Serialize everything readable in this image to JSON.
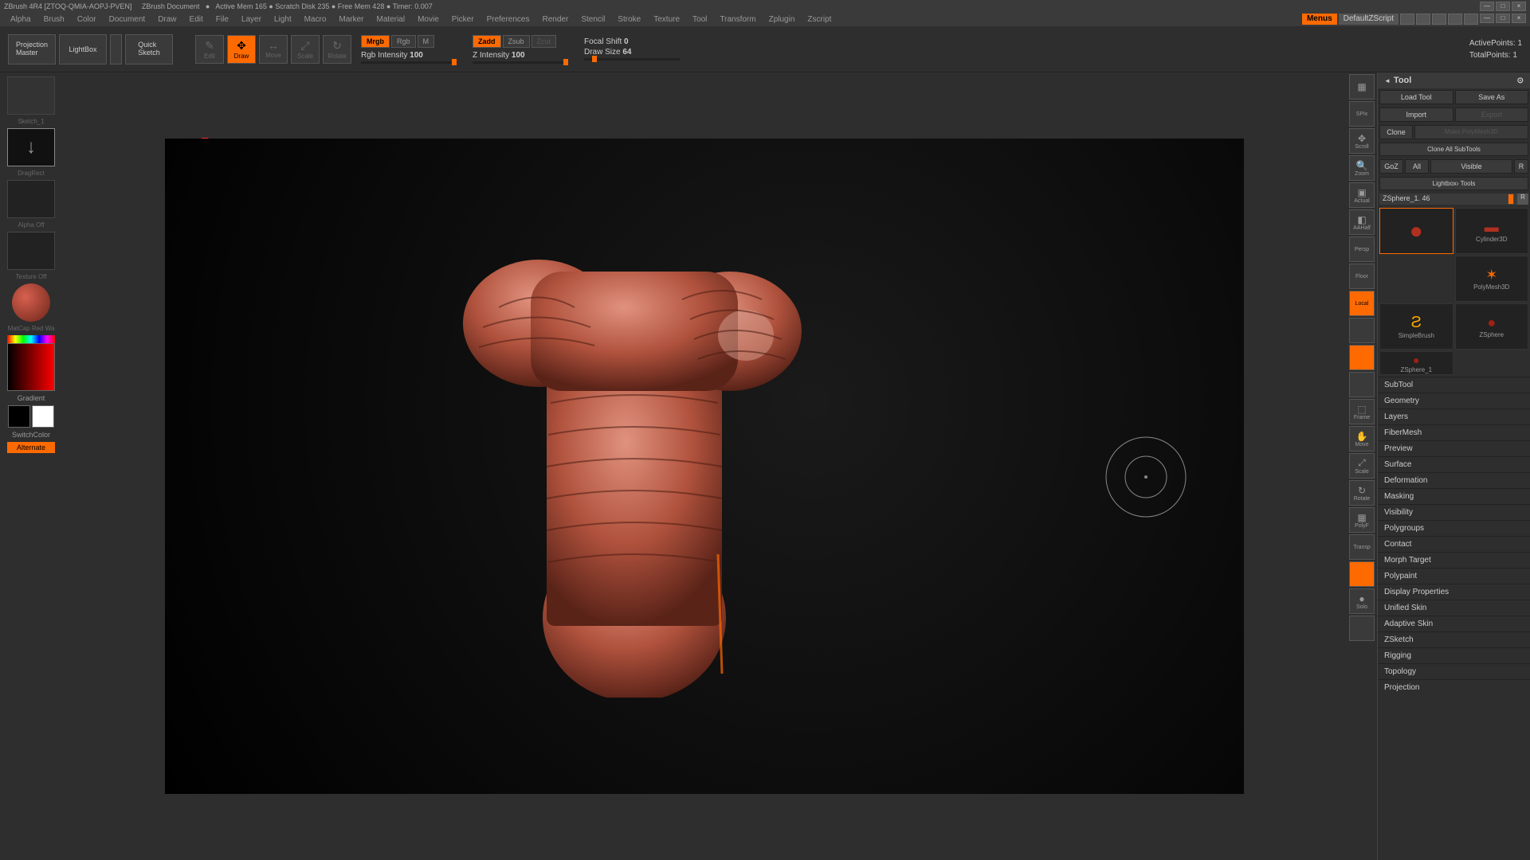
{
  "titlebar": {
    "app": "ZBrush 4R4 [ZTOQ-QMIA-AOPJ-PVEN]",
    "doc": "ZBrush Document",
    "stats": "Active Mem 165 ● Scratch Disk 235 ● Free Mem 428 ● Timer: 0.007"
  },
  "menubar": {
    "items": [
      "Alpha",
      "Brush",
      "Color",
      "Document",
      "Draw",
      "Edit",
      "File",
      "Layer",
      "Light",
      "Macro",
      "Marker",
      "Material",
      "Movie",
      "Picker",
      "Preferences",
      "Render",
      "Stencil",
      "Stroke",
      "Texture",
      "Tool",
      "Transform",
      "Zplugin",
      "Zscript"
    ],
    "menus_btn": "Menus",
    "default_script": "DefaultZScript"
  },
  "toolbar": {
    "projection_master": "Projection\nMaster",
    "lightbox": "LightBox",
    "quick_sketch": "Quick\nSketch",
    "modes": {
      "edit": "Edit",
      "draw": "Draw",
      "move": "Move",
      "scale": "Scale",
      "rotate": "Rotate"
    },
    "rgb_modes": {
      "mrgb": "Mrgb",
      "rgb": "Rgb",
      "m": "M"
    },
    "z_modes": {
      "zadd": "Zadd",
      "zsub": "Zsub",
      "zcut": "Zcut"
    },
    "rgb_intensity": {
      "label": "Rgb Intensity",
      "value": "100"
    },
    "z_intensity": {
      "label": "Z Intensity",
      "value": "100"
    },
    "focal_shift": {
      "label": "Focal Shift",
      "value": "0"
    },
    "draw_size": {
      "label": "Draw Size",
      "value": "64"
    },
    "active_points": {
      "label": "ActivePoints:",
      "value": "1"
    },
    "total_points": {
      "label": "TotalPoints:",
      "value": "1"
    }
  },
  "left_panel": {
    "sketch_label": "Sketch_1",
    "drag_rect": "DragRect",
    "alpha_off": "Alpha Off",
    "texture_off": "Texture Off",
    "material": "MatCap Red Wa",
    "gradient": "Gradient",
    "switch_color": "SwitchColor",
    "alternate": "Alternate"
  },
  "right_tools": {
    "items": [
      "",
      "SPix",
      "Scroll",
      "Zoom",
      "Actual",
      "AAHalf",
      "Persp",
      "Floor",
      "Local",
      "",
      "",
      "",
      "Frame",
      "Move",
      "Scale",
      "Rotate",
      "PolyF",
      "Transp",
      "",
      "Solo",
      ""
    ]
  },
  "tool_panel": {
    "title": "Tool",
    "load_tool": "Load Tool",
    "save_as": "Save As",
    "import": "Import",
    "export": "Export",
    "clone": "Clone",
    "make_polymesh": "Make PolyMesh3D",
    "clone_all": "Clone All SubTools",
    "goz": "GoZ",
    "all": "All",
    "visible": "Visible",
    "r": "R",
    "lightbox_tools": "Lightbox› Tools",
    "zsphere_slider": "ZSphere_1. 46",
    "tools": {
      "cylinder": "Cylinder3D",
      "polymesh": "PolyMesh3D",
      "simplebrush": "SimpleBrush",
      "zsphere": "ZSphere",
      "zsphere1": "ZSphere_1"
    },
    "accordions": [
      "SubTool",
      "Geometry",
      "Layers",
      "FiberMesh",
      "Preview",
      "Surface",
      "Deformation",
      "Masking",
      "Visibility",
      "Polygroups",
      "Contact",
      "Morph Target",
      "Polypaint",
      "Display Properties",
      "Unified Skin",
      "Adaptive Skin",
      "ZSketch",
      "Rigging",
      "Topology",
      "Projection"
    ]
  }
}
